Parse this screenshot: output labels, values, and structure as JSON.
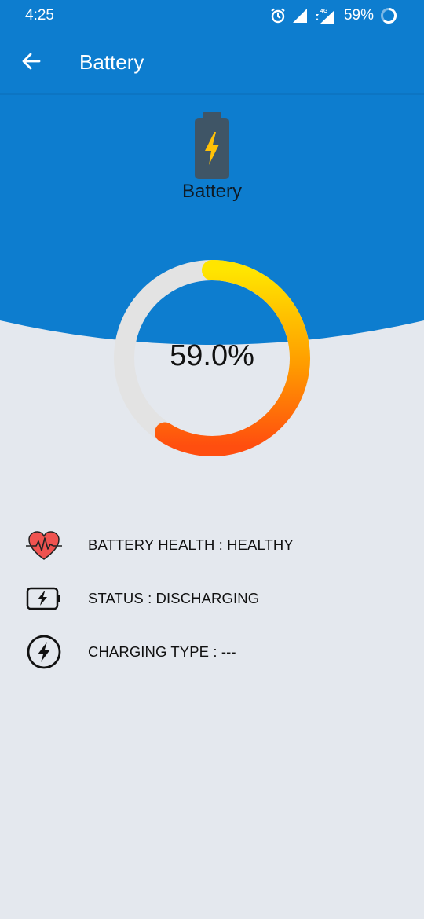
{
  "status_bar": {
    "time": "4:25",
    "battery_percent": "59%",
    "network_label": "4G",
    "icons": [
      "alarm-icon",
      "wifi-signal-icon",
      "cellular-signal-icon",
      "battery-ring-icon"
    ]
  },
  "app_bar": {
    "title": "Battery",
    "back_icon": "arrow-left-icon"
  },
  "hero": {
    "label": "Battery",
    "icon": "battery-charging-icon"
  },
  "gauge": {
    "value_text": "59.0%",
    "fraction": 0.59,
    "colors": {
      "track": "#e3e3e3",
      "start": "#ffe500",
      "end": "#ff4e0f"
    }
  },
  "info": [
    {
      "icon": "heart-pulse-icon",
      "text": "BATTERY HEALTH : HEALTHY"
    },
    {
      "icon": "battery-bolt-icon",
      "text": "STATUS : DISCHARGING"
    },
    {
      "icon": "bolt-circle-icon",
      "text": "CHARGING TYPE : ---"
    }
  ],
  "colors": {
    "header_blue": "#0d7dcf",
    "background": "#e4e8ee"
  }
}
